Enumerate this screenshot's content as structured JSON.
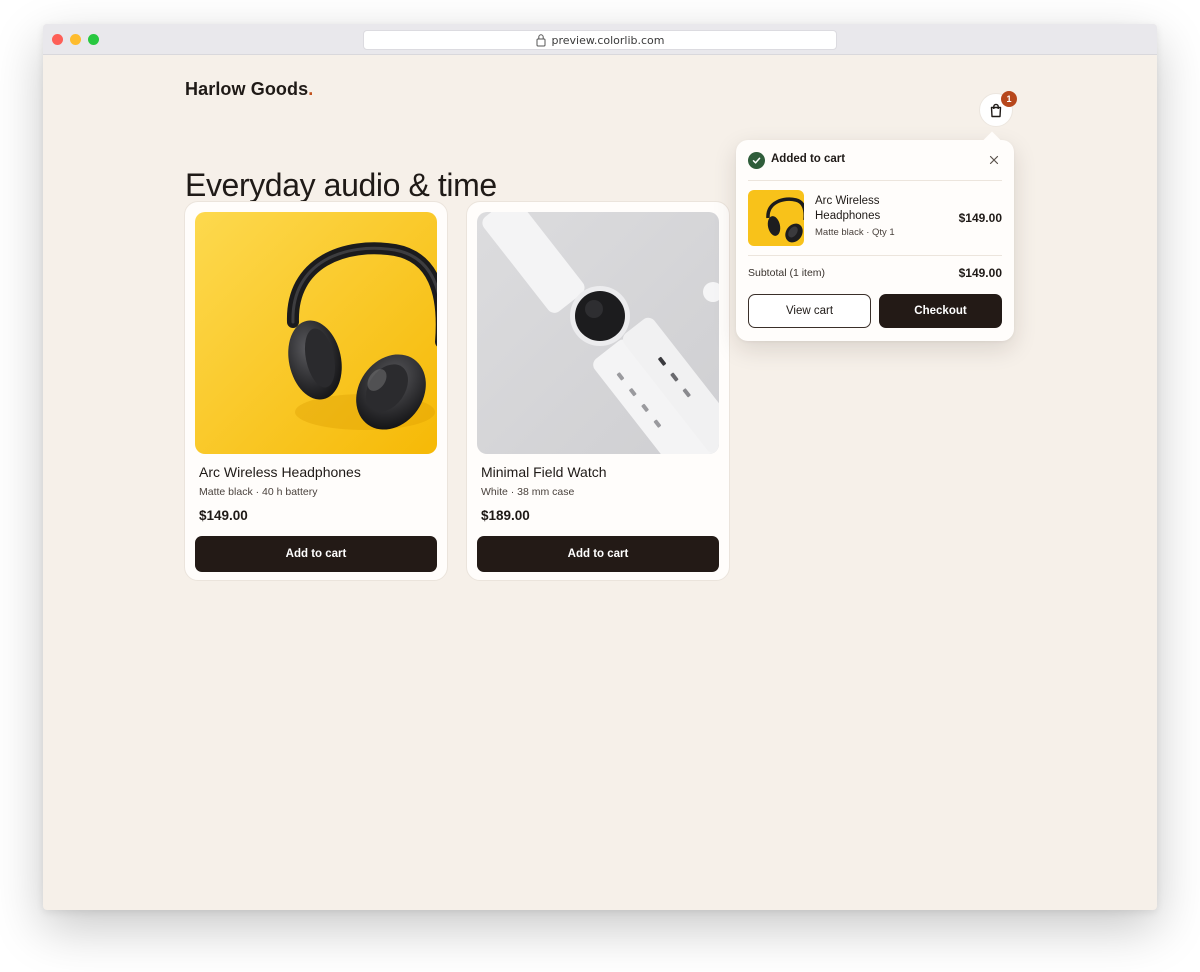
{
  "browser": {
    "url": "preview.colorlib.com"
  },
  "header": {
    "brand": "Harlow Goods",
    "brand_dot": ".",
    "cart_count": "1"
  },
  "main": {
    "heading": "Everyday audio & time",
    "products": [
      {
        "name": "Arc Wireless Headphones",
        "meta": "Matte black · 40 h battery",
        "price": "$149.00",
        "button": "Add to cart",
        "image_icon": "headphones-image"
      },
      {
        "name": "Minimal Field Watch",
        "meta": "White · 38 mm case",
        "price": "$189.00",
        "button": "Add to cart",
        "image_icon": "watch-image"
      }
    ]
  },
  "cart_popover": {
    "title": "Added to cart",
    "item": {
      "name": "Arc Wireless Headphones",
      "meta": "Matte black · Qty 1",
      "price": "$149.00"
    },
    "subtotal_label": "Subtotal (1 item)",
    "subtotal_value": "$149.00",
    "view_cart": "View cart",
    "checkout": "Checkout"
  },
  "colors": {
    "background": "#f6f0e9",
    "primary_button": "#231a16",
    "accent": "#c2531f",
    "badge": "#b7471c",
    "success": "#2f5d3a",
    "headphones_bg": "#f8c21a",
    "watch_bg": "#d9d9db"
  }
}
